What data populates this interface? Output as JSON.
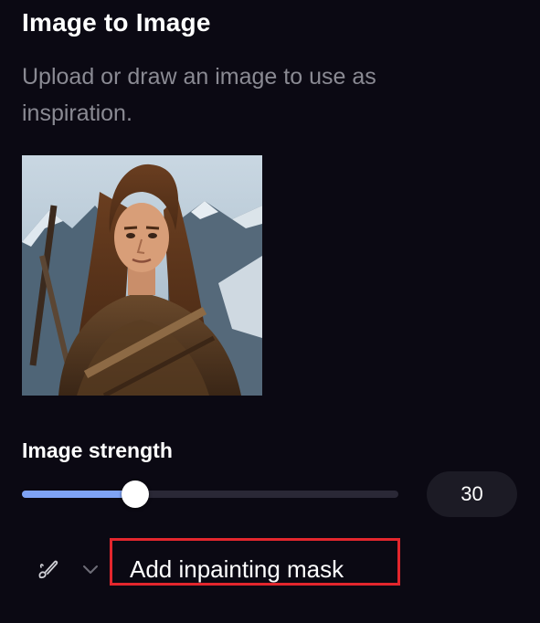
{
  "panel": {
    "title": "Image to Image",
    "description": "Upload or draw an image to use as inspiration."
  },
  "init_image": {
    "icon": "uploaded-image-thumbnail"
  },
  "strength": {
    "label": "Image strength",
    "value": "30",
    "fraction": 0.3
  },
  "mask": {
    "brush_icon": "brush-icon",
    "chevron_icon": "chevron-down-icon",
    "button_label": "Add inpainting mask"
  },
  "colors": {
    "background": "#0b0913",
    "accent": "#7fa3f5",
    "highlight_border": "#e3262d",
    "muted_text": "#8a8a93"
  }
}
